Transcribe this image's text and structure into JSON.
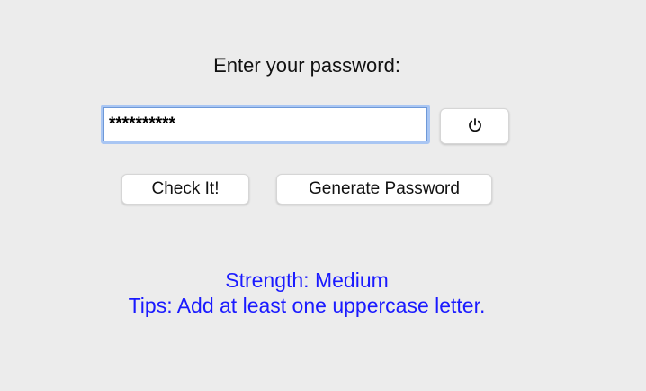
{
  "form": {
    "prompt_label": "Enter your password:",
    "password_value": "**********",
    "reset_icon": "power-icon",
    "check_button_label": "Check It!",
    "generate_button_label": "Generate Password"
  },
  "result": {
    "strength_text": "Strength: Medium",
    "tips_text": "Tips: Add at least one uppercase letter.",
    "text_color": "#1a1aff"
  },
  "colors": {
    "background": "#ececec",
    "input_focus_border": "#a9c6f3"
  }
}
